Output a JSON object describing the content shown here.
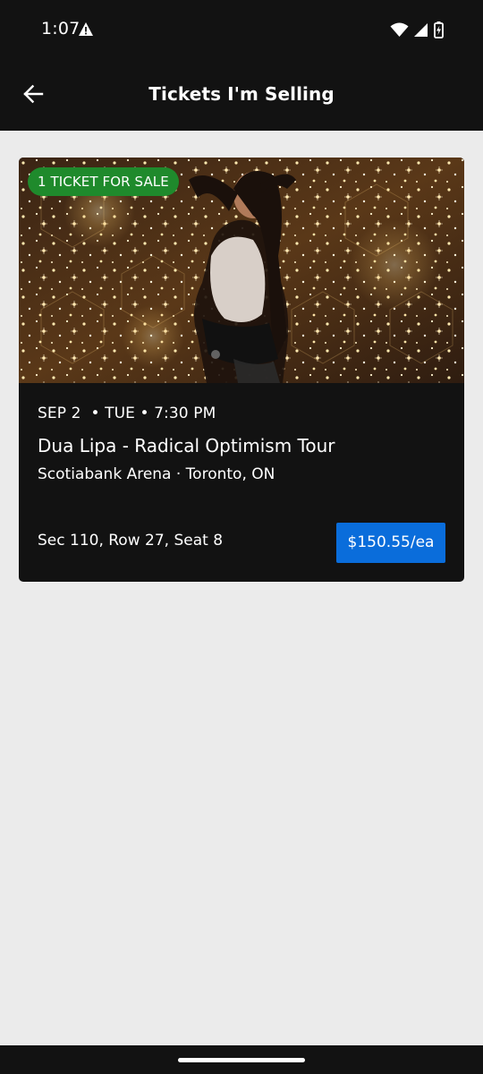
{
  "status_bar": {
    "time": "1:07",
    "icons": [
      "warning-icon",
      "wifi-icon",
      "signal-icon",
      "battery-charging-icon"
    ]
  },
  "app_bar": {
    "title": "Tickets I'm Selling",
    "back_icon": "back-arrow-icon"
  },
  "ticket": {
    "badge": "1 TICKET FOR SALE",
    "date_line": "SEP 2  • TUE • 7:30 PM",
    "event_name": "Dua Lipa - Radical Optimism Tour",
    "venue": "Scotiabank Arena · Toronto, ON",
    "seat": "Sec 110, Row 27, Seat 8",
    "price_label": "$150.55/ea"
  },
  "colors": {
    "bar_background": "#121212",
    "page_background": "#ebebeb",
    "badge_green": "#1f8a2c",
    "price_blue": "#0a6ddb"
  }
}
